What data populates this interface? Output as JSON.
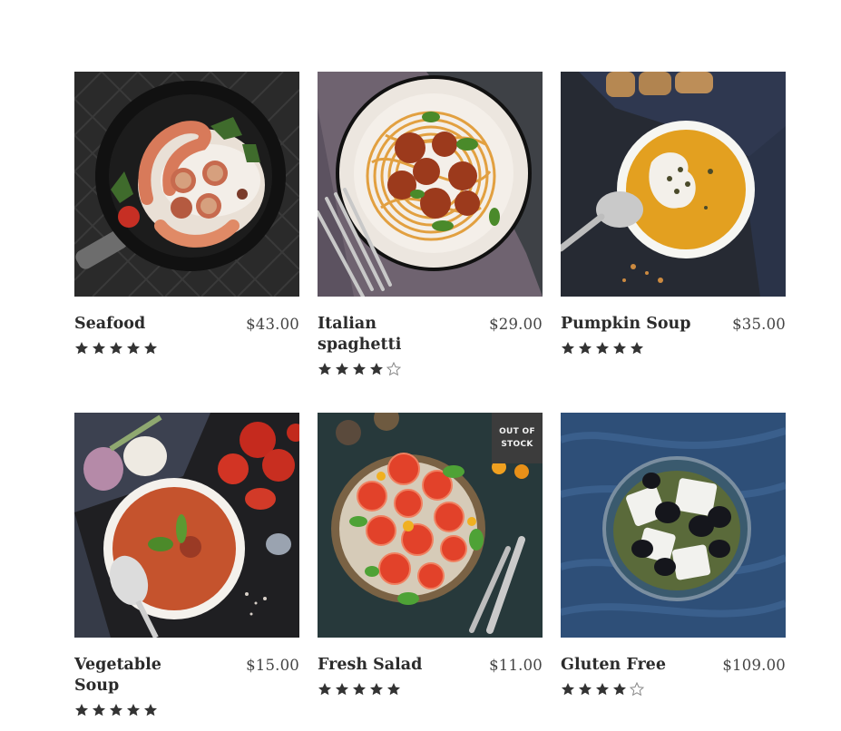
{
  "products": [
    {
      "name": "Seafood",
      "price": "$43.00",
      "rating": 5,
      "image_icon": "seafood-pan-image"
    },
    {
      "name": "Italian spaghetti",
      "price": "$29.00",
      "rating": 4,
      "image_icon": "spaghetti-meatballs-image"
    },
    {
      "name": "Pumpkin Soup",
      "price": "$35.00",
      "rating": 5,
      "image_icon": "pumpkin-soup-image"
    },
    {
      "name": "Vegetable Soup",
      "price": "$15.00",
      "rating": 5,
      "image_icon": "vegetable-soup-image"
    },
    {
      "name": "Fresh Salad",
      "price": "$11.00",
      "rating": 5,
      "image_icon": "fresh-salad-image",
      "badge": "OUT OF STOCK"
    },
    {
      "name": "Gluten Free",
      "price": "$109.00",
      "rating": 4,
      "image_icon": "feta-olives-image"
    }
  ],
  "colors": {
    "text": "#2b2b2b",
    "star": "#333333",
    "badge_bg": "#3c3c3c"
  }
}
